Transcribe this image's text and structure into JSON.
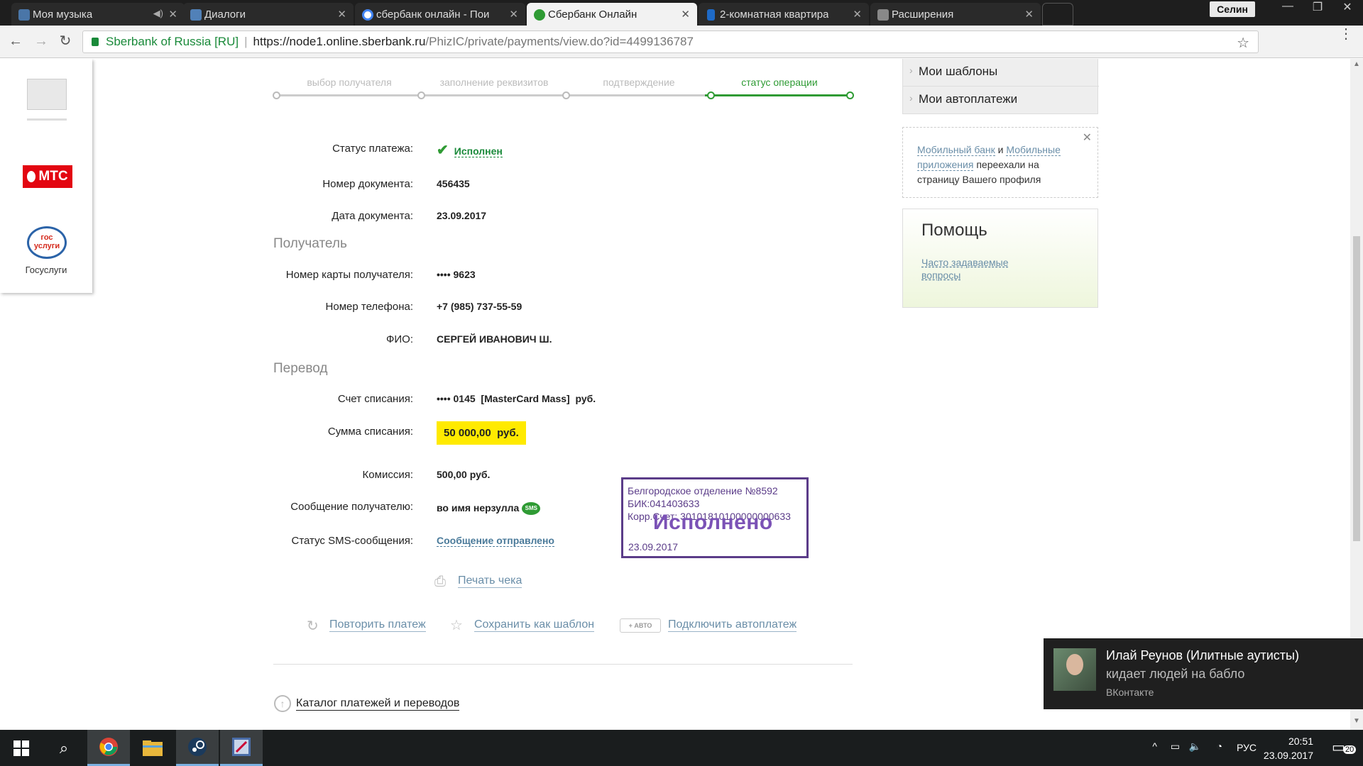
{
  "browser": {
    "tabs": [
      {
        "label": "Моя музыка",
        "icon": "vk-icon",
        "color": "#4a76a8"
      },
      {
        "label": "Диалоги",
        "icon": "vk-dialog-icon",
        "color": "#5181b8"
      },
      {
        "label": "сбербанк онлайн - Пои",
        "icon": "google-icon",
        "color": "#4285f4"
      },
      {
        "label": "Сбербанк Онлайн",
        "icon": "sberbank-icon",
        "color": "#2f9b34"
      },
      {
        "label": "2-комнатная квартира",
        "icon": "bookmark-icon",
        "color": "#1e6ac7"
      },
      {
        "label": "Расширения",
        "icon": "puzzle-icon",
        "color": "#888888"
      }
    ],
    "user": "Селин",
    "secure_label": "Sberbank of Russia [RU]",
    "url_host": "https://node1.online.sberbank.ru",
    "url_path": "/PhizIC/private/payments/view.do?id=4499136787"
  },
  "sidebar": {
    "mts_label": "МТС",
    "gos_label": "гос услуги",
    "gosuslugi": "Госуслуги"
  },
  "steps": [
    "выбор получателя",
    "заполнение реквизитов",
    "подтверждение",
    "статус операции"
  ],
  "details": {
    "status_label": "Статус платежа:",
    "status_value": "Исполнен",
    "doc_num_label": "Номер документа:",
    "doc_num": "456435",
    "doc_date_label": "Дата документа:",
    "doc_date": "23.09.2017",
    "recipient_section": "Получатель",
    "card_label": "Номер карты получателя:",
    "card": "•••• 9623",
    "phone_label": "Номер телефона:",
    "phone": "+7 (985) 737-55-59",
    "fio_label": "ФИО:",
    "fio": "СЕРГЕЙ ИВАНОВИЧ Ш.",
    "transfer_section": "Перевод",
    "account_label": "Счет списания:",
    "account": "•••• 0145  [MasterCard Mass]  руб.",
    "sum_label": "Сумма списания:",
    "sum": "50 000,00  руб.",
    "fee_label": "Комиссия:",
    "fee": "500,00 руб.",
    "message_label": "Сообщение получателю:",
    "message": "во имя нерзулла",
    "sms_badge": "SMS",
    "sms_status_label": "Статус SMS-сообщения:",
    "sms_status": "Сообщение отправлено"
  },
  "stamp": {
    "line1": "Белгородское отделение №8592",
    "line2": "БИК:041403633",
    "line3": "Корр.Счет: 30101810100000000633",
    "big": "Исполнено",
    "date": "23.09.2017"
  },
  "actions": {
    "print": "Печать чека",
    "repeat": "Повторить платеж",
    "save_template": "Сохранить как шаблон",
    "avto_badge": "+ АВТО",
    "autopay": "Подключить автоплатеж",
    "catalog": "Каталог платежей и переводов"
  },
  "right": {
    "menu": [
      "Мои шаблоны",
      "Мои автоплатежи"
    ],
    "notice_link1": "Мобильный банк",
    "notice_and": " и ",
    "notice_link2": "Мобильные приложения",
    "notice_text": " переехали на страницу Вашего профиля",
    "help_title": "Помощь",
    "help_link": "Часто задаваемые вопросы"
  },
  "toast": {
    "title": "Илай Реунов (Илитные аутисты)",
    "body": "кидает людей на бабло",
    "source": "ВКонтакте"
  },
  "taskbar": {
    "lang": "РУС",
    "time": "20:51",
    "date": "23.09.2017",
    "notifications": "20"
  }
}
